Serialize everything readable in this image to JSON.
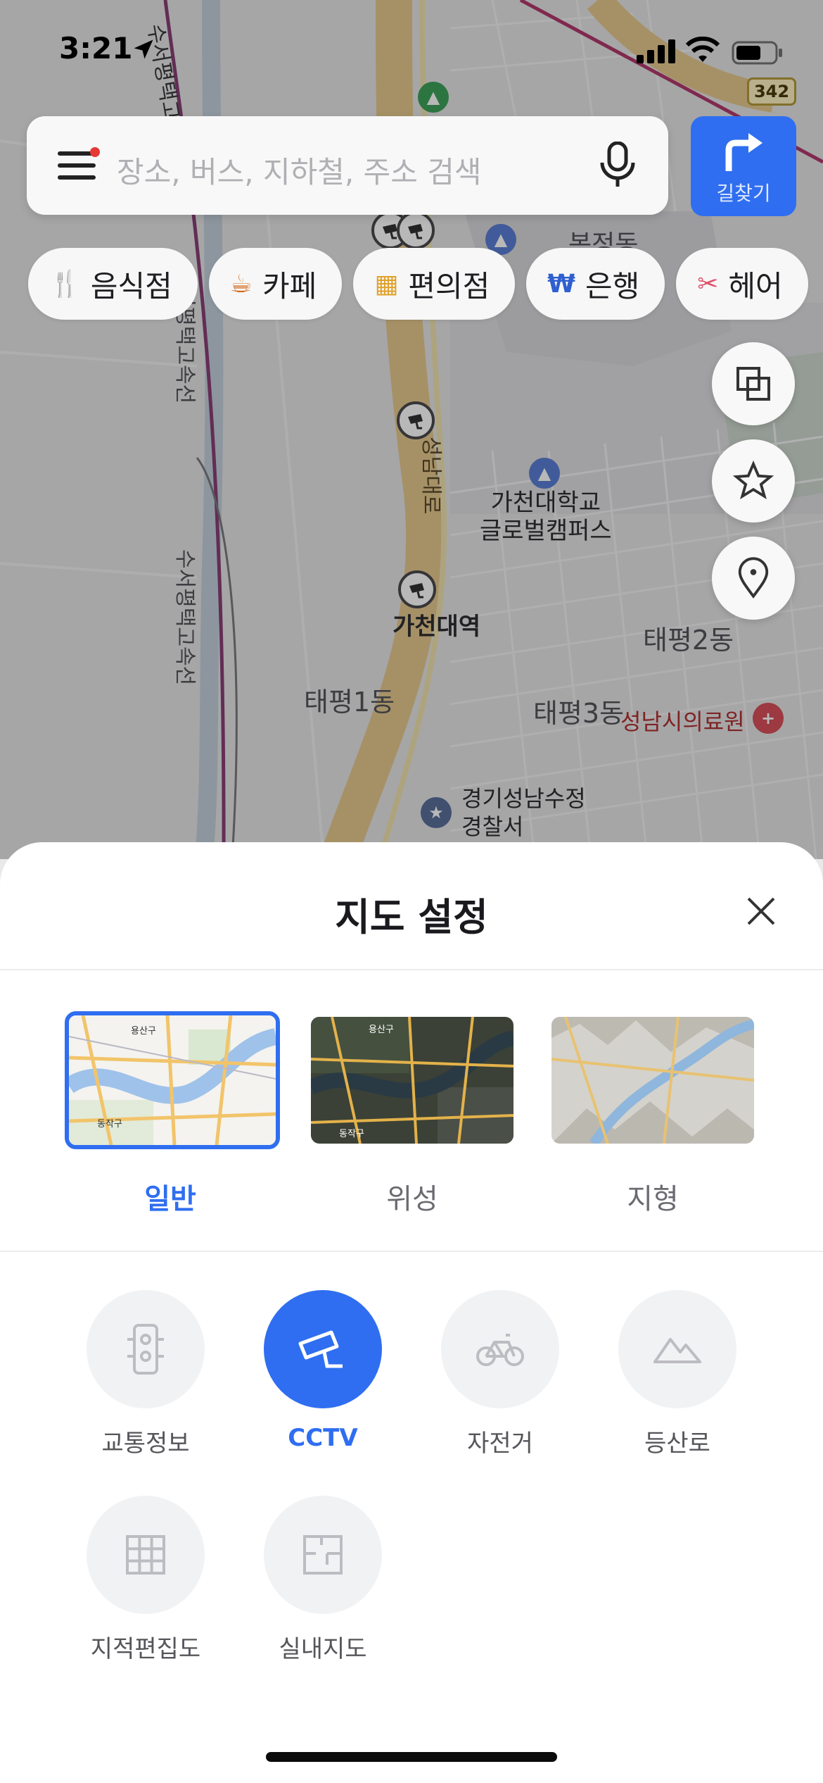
{
  "status_bar": {
    "time": "3:21"
  },
  "search": {
    "placeholder": "장소, 버스, 지하철, 주소 검색"
  },
  "route_button": {
    "label": "길찾기"
  },
  "chips": [
    {
      "label": "음식점",
      "icon": "fork-knife-icon",
      "color": "#e07b3b"
    },
    {
      "label": "카페",
      "icon": "coffee-cup-icon",
      "color": "#d2691e"
    },
    {
      "label": "편의점",
      "icon": "store-icon",
      "color": "#e0a12a"
    },
    {
      "label": "은행",
      "icon": "won-icon",
      "color": "#2f5fd0"
    },
    {
      "label": "헤어",
      "icon": "scissors-icon",
      "color": "#e0506a"
    }
  ],
  "map": {
    "labels": {
      "station": "가천대역",
      "university": "가천대학교\n글로벌캠퍼스",
      "district1": "태평1동",
      "district2": "태평2동",
      "district3": "태평3동",
      "clinic": "성남시의료원",
      "police": "경기성남수정\n경찰서",
      "bokjeong": "복정동",
      "highway_left": "수서평택고속선",
      "highway_left2": "수서평택고속선",
      "road_number": "342",
      "road_name": "성남대로",
      "top_road": "수서평택고"
    }
  },
  "sheet": {
    "title": "지도 설정",
    "map_types": [
      {
        "label": "일반",
        "selected": true
      },
      {
        "label": "위성",
        "selected": false
      },
      {
        "label": "지형",
        "selected": false
      }
    ],
    "layers": [
      {
        "label": "교통정보",
        "icon": "traffic-light-icon",
        "on": false
      },
      {
        "label": "CCTV",
        "icon": "cctv-icon",
        "on": true
      },
      {
        "label": "자전거",
        "icon": "bicycle-icon",
        "on": false
      },
      {
        "label": "등산로",
        "icon": "mountain-icon",
        "on": false
      },
      {
        "label": "지적편집도",
        "icon": "grid-icon",
        "on": false
      },
      {
        "label": "실내지도",
        "icon": "floorplan-icon",
        "on": false
      }
    ],
    "thumb_labels": {
      "general": "용산구",
      "general2": "동작구",
      "satellite": "용산구",
      "satellite2": "동작구"
    }
  },
  "colors": {
    "accent": "#2f6ef0"
  }
}
